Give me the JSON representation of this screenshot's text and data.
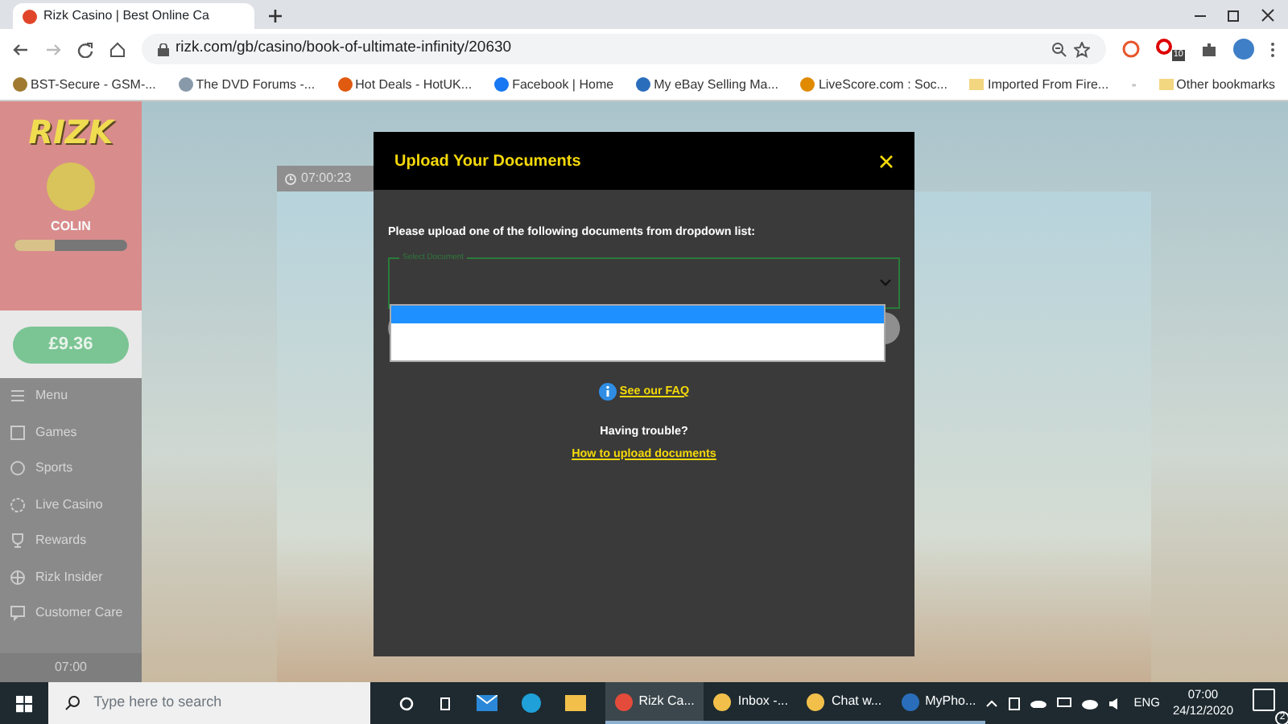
{
  "browser": {
    "tab_title": "Rizk Casino | Best Online Ca",
    "url": "rizk.com/gb/casino/book-of-ultimate-infinity/20630",
    "extension_badge": "10",
    "bookmarks": [
      {
        "label": "BST-Secure - GSM-..."
      },
      {
        "label": "The DVD Forums -..."
      },
      {
        "label": "Hot Deals - HotUK..."
      },
      {
        "label": "Facebook | Home"
      },
      {
        "label": "My eBay Selling Ma..."
      },
      {
        "label": "LiveScore.com : Soc..."
      },
      {
        "label": "Imported From Fire..."
      }
    ],
    "other_bookmarks": "Other bookmarks"
  },
  "sidebar": {
    "logo": "RIZK",
    "username": "COLIN",
    "level": 0.35,
    "balance": "£9.36",
    "items": [
      {
        "label": "Menu"
      },
      {
        "label": "Games"
      },
      {
        "label": "Sports"
      },
      {
        "label": "Live Casino"
      },
      {
        "label": "Rewards"
      },
      {
        "label": "Rizk Insider"
      },
      {
        "label": "Customer Care"
      }
    ],
    "time": "07:00"
  },
  "game": {
    "timer": "07:00:23"
  },
  "modal": {
    "title": "Upload Your Documents",
    "instruction": "Please upload one of the following documents from dropdown list:",
    "field_label": "Select Document",
    "options": [
      {
        "selected": true
      },
      {
        "selected": false
      }
    ],
    "faq_link": "See our FAQ",
    "trouble": "Having trouble?",
    "help_link": "How to upload documents"
  },
  "taskbar": {
    "search_placeholder": "Type here to search",
    "apps": [
      {
        "label": "Rizk Ca...",
        "selected": true
      },
      {
        "label": "Inbox -...",
        "selected": false
      },
      {
        "label": "Chat w...",
        "selected": false
      },
      {
        "label": "MyPho...",
        "selected": false
      }
    ],
    "language": "ENG",
    "time": "07:00",
    "date": "24/12/2020",
    "notifications": "2"
  }
}
